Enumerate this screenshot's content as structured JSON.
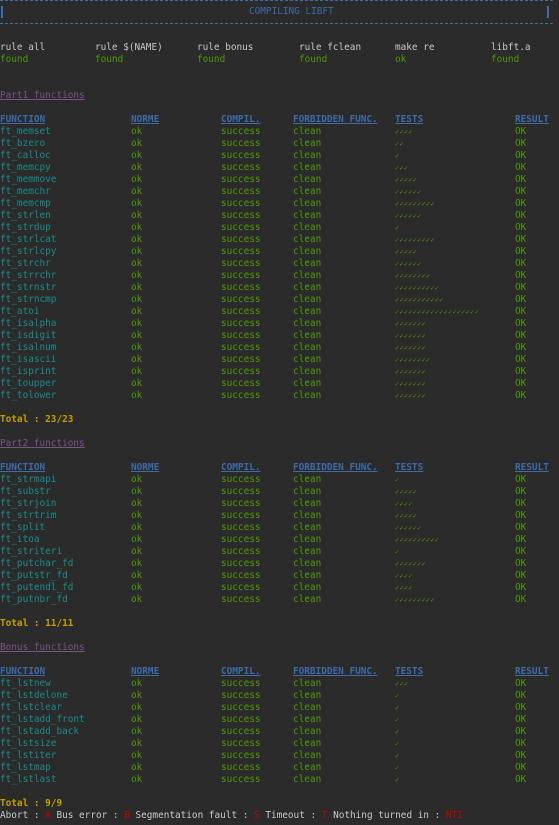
{
  "title": "COMPILING LIBFT",
  "colors": {
    "header_blue": "#3e6aa8",
    "function_cyan": "#1b8c8c",
    "ok_green": "#4e9a06",
    "section_purple": "#7a5585",
    "total_yellow": "#c4a000",
    "error_red": "#cc0000",
    "background": "#2b2b2b"
  },
  "rules": [
    {
      "label": "rule all",
      "status": "found"
    },
    {
      "label": "rule $(NAME)",
      "status": "found"
    },
    {
      "label": "rule bonus",
      "status": "found"
    },
    {
      "label": "rule fclean",
      "status": "found"
    },
    {
      "label": "make re",
      "status": "ok"
    },
    {
      "label": "libft.a",
      "status": "found"
    }
  ],
  "columns": [
    "FUNCTION",
    "NORME",
    "COMPIL.",
    "FORBIDDEN FUNC.",
    "TESTS",
    "RESULT"
  ],
  "check_glyph": "✓",
  "sections": [
    {
      "title": "Part1 functions",
      "total": "Total : 23/23",
      "rows": [
        {
          "function": "ft_memset",
          "norme": "ok",
          "compil": "success",
          "forbidden": "clean",
          "tests": 4,
          "result": "OK"
        },
        {
          "function": "ft_bzero",
          "norme": "ok",
          "compil": "success",
          "forbidden": "clean",
          "tests": 2,
          "result": "OK"
        },
        {
          "function": "ft_calloc",
          "norme": "ok",
          "compil": "success",
          "forbidden": "clean",
          "tests": 1,
          "result": "OK"
        },
        {
          "function": "ft_memcpy",
          "norme": "ok",
          "compil": "success",
          "forbidden": "clean",
          "tests": 3,
          "result": "OK"
        },
        {
          "function": "ft_memmove",
          "norme": "ok",
          "compil": "success",
          "forbidden": "clean",
          "tests": 5,
          "result": "OK"
        },
        {
          "function": "ft_memchr",
          "norme": "ok",
          "compil": "success",
          "forbidden": "clean",
          "tests": 6,
          "result": "OK"
        },
        {
          "function": "ft_memcmp",
          "norme": "ok",
          "compil": "success",
          "forbidden": "clean",
          "tests": 9,
          "result": "OK"
        },
        {
          "function": "ft_strlen",
          "norme": "ok",
          "compil": "success",
          "forbidden": "clean",
          "tests": 6,
          "result": "OK"
        },
        {
          "function": "ft_strdup",
          "norme": "ok",
          "compil": "success",
          "forbidden": "clean",
          "tests": 1,
          "result": "OK"
        },
        {
          "function": "ft_strlcat",
          "norme": "ok",
          "compil": "success",
          "forbidden": "clean",
          "tests": 9,
          "result": "OK"
        },
        {
          "function": "ft_strlcpy",
          "norme": "ok",
          "compil": "success",
          "forbidden": "clean",
          "tests": 5,
          "result": "OK"
        },
        {
          "function": "ft_strchr",
          "norme": "ok",
          "compil": "success",
          "forbidden": "clean",
          "tests": 6,
          "result": "OK"
        },
        {
          "function": "ft_strrchr",
          "norme": "ok",
          "compil": "success",
          "forbidden": "clean",
          "tests": 8,
          "result": "OK"
        },
        {
          "function": "ft_strnstr",
          "norme": "ok",
          "compil": "success",
          "forbidden": "clean",
          "tests": 10,
          "result": "OK"
        },
        {
          "function": "ft_strncmp",
          "norme": "ok",
          "compil": "success",
          "forbidden": "clean",
          "tests": 11,
          "result": "OK"
        },
        {
          "function": "ft_atoi",
          "norme": "ok",
          "compil": "success",
          "forbidden": "clean",
          "tests": 19,
          "result": "OK"
        },
        {
          "function": "ft_isalpha",
          "norme": "ok",
          "compil": "success",
          "forbidden": "clean",
          "tests": 7,
          "result": "OK"
        },
        {
          "function": "ft_isdigit",
          "norme": "ok",
          "compil": "success",
          "forbidden": "clean",
          "tests": 7,
          "result": "OK"
        },
        {
          "function": "ft_isalnum",
          "norme": "ok",
          "compil": "success",
          "forbidden": "clean",
          "tests": 7,
          "result": "OK"
        },
        {
          "function": "ft_isascii",
          "norme": "ok",
          "compil": "success",
          "forbidden": "clean",
          "tests": 8,
          "result": "OK"
        },
        {
          "function": "ft_isprint",
          "norme": "ok",
          "compil": "success",
          "forbidden": "clean",
          "tests": 7,
          "result": "OK"
        },
        {
          "function": "ft_toupper",
          "norme": "ok",
          "compil": "success",
          "forbidden": "clean",
          "tests": 7,
          "result": "OK"
        },
        {
          "function": "ft_tolower",
          "norme": "ok",
          "compil": "success",
          "forbidden": "clean",
          "tests": 7,
          "result": "OK"
        }
      ]
    },
    {
      "title": "Part2 functions",
      "total": "Total : 11/11",
      "rows": [
        {
          "function": "ft_strmapi",
          "norme": "ok",
          "compil": "success",
          "forbidden": "clean",
          "tests": 1,
          "result": "OK"
        },
        {
          "function": "ft_substr",
          "norme": "ok",
          "compil": "success",
          "forbidden": "clean",
          "tests": 5,
          "result": "OK"
        },
        {
          "function": "ft_strjoin",
          "norme": "ok",
          "compil": "success",
          "forbidden": "clean",
          "tests": 4,
          "result": "OK"
        },
        {
          "function": "ft_strtrim",
          "norme": "ok",
          "compil": "success",
          "forbidden": "clean",
          "tests": 5,
          "result": "OK"
        },
        {
          "function": "ft_split",
          "norme": "ok",
          "compil": "success",
          "forbidden": "clean",
          "tests": 6,
          "result": "OK"
        },
        {
          "function": "ft_itoa",
          "norme": "ok",
          "compil": "success",
          "forbidden": "clean",
          "tests": 10,
          "result": "OK"
        },
        {
          "function": "ft_striteri",
          "norme": "ok",
          "compil": "success",
          "forbidden": "clean",
          "tests": 1,
          "result": "OK"
        },
        {
          "function": "ft_putchar_fd",
          "norme": "ok",
          "compil": "success",
          "forbidden": "clean",
          "tests": 7,
          "result": "OK"
        },
        {
          "function": "ft_putstr_fd",
          "norme": "ok",
          "compil": "success",
          "forbidden": "clean",
          "tests": 4,
          "result": "OK"
        },
        {
          "function": "ft_putendl_fd",
          "norme": "ok",
          "compil": "success",
          "forbidden": "clean",
          "tests": 4,
          "result": "OK"
        },
        {
          "function": "ft_putnbr_fd",
          "norme": "ok",
          "compil": "success",
          "forbidden": "clean",
          "tests": 9,
          "result": "OK"
        }
      ]
    },
    {
      "title": "Bonus functions",
      "total": "Total : 9/9",
      "rows": [
        {
          "function": "ft_lstnew",
          "norme": "ok",
          "compil": "success",
          "forbidden": "clean",
          "tests": 3,
          "result": "OK"
        },
        {
          "function": "ft_lstdelone",
          "norme": "ok",
          "compil": "success",
          "forbidden": "clean",
          "tests": 1,
          "result": "OK"
        },
        {
          "function": "ft_lstclear",
          "norme": "ok",
          "compil": "success",
          "forbidden": "clean",
          "tests": 1,
          "result": "OK"
        },
        {
          "function": "ft_lstadd_front",
          "norme": "ok",
          "compil": "success",
          "forbidden": "clean",
          "tests": 1,
          "result": "OK"
        },
        {
          "function": "ft_lstadd_back",
          "norme": "ok",
          "compil": "success",
          "forbidden": "clean",
          "tests": 1,
          "result": "OK"
        },
        {
          "function": "ft_lstsize",
          "norme": "ok",
          "compil": "success",
          "forbidden": "clean",
          "tests": 1,
          "result": "OK"
        },
        {
          "function": "ft_lstiter",
          "norme": "ok",
          "compil": "success",
          "forbidden": "clean",
          "tests": 1,
          "result": "OK"
        },
        {
          "function": "ft_lstmap",
          "norme": "ok",
          "compil": "success",
          "forbidden": "clean",
          "tests": 1,
          "result": "OK"
        },
        {
          "function": "ft_lstlast",
          "norme": "ok",
          "compil": "success",
          "forbidden": "clean",
          "tests": 1,
          "result": "OK"
        }
      ]
    }
  ],
  "legend": [
    {
      "label": "Abort : ",
      "code": "A"
    },
    {
      "label": " Bus error : ",
      "code": "B"
    },
    {
      "label": " Segmentation fault : ",
      "code": "S"
    },
    {
      "label": " Timeout : ",
      "code": "T"
    },
    {
      "label": " Nothing turned in : ",
      "code": "NTI"
    }
  ]
}
